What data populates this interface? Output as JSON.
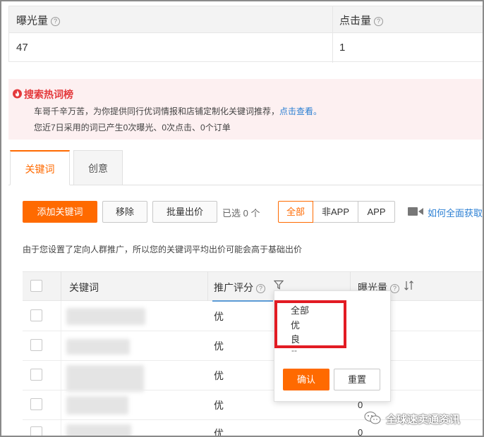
{
  "stats": {
    "col1_label": "曝光量",
    "col1_value": "47",
    "col2_label": "点击量",
    "col2_value": "1"
  },
  "banner": {
    "title": "搜索热词榜",
    "line1_text": "车哥千辛万苦，为你提供同行优词情报和店铺定制化关键词推荐，",
    "line1_link": "点击查看。",
    "line2_text": "您近7日采用的词已产生0次曝光、0次点击、0个订单"
  },
  "tabs": [
    {
      "label": "关键词",
      "active": true
    },
    {
      "label": "创意",
      "active": false
    }
  ],
  "toolbar": {
    "add_label": "添加关键词",
    "remove_label": "移除",
    "bid_label": "批量出价",
    "selected_text": "已选 0 个",
    "segments": [
      "全部",
      "非APP",
      "APP"
    ],
    "howto_link": "如何全面获取"
  },
  "notice": "由于您设置了定向人群推广，所以您的关键词平均出价可能会高于基础出价",
  "table": {
    "headers": {
      "keyword": "关键词",
      "score": "推广评分",
      "exposure": "曝光量"
    },
    "rows": [
      {
        "score": "优",
        "extra": ""
      },
      {
        "score": "优",
        "extra": ""
      },
      {
        "score": "优",
        "extra": ""
      },
      {
        "score": "优",
        "extra": "0"
      },
      {
        "score": "优",
        "extra": "0"
      }
    ]
  },
  "dropdown": {
    "options": [
      "全部",
      "优",
      "良"
    ],
    "more": "--",
    "confirm_label": "确认",
    "reset_label": "重置"
  },
  "watermark": "全球速卖通资讯",
  "colors": {
    "accent": "#ff6a00",
    "link": "#2b7fd3",
    "alert": "#e4393c",
    "highlight_box": "#e21b23"
  }
}
